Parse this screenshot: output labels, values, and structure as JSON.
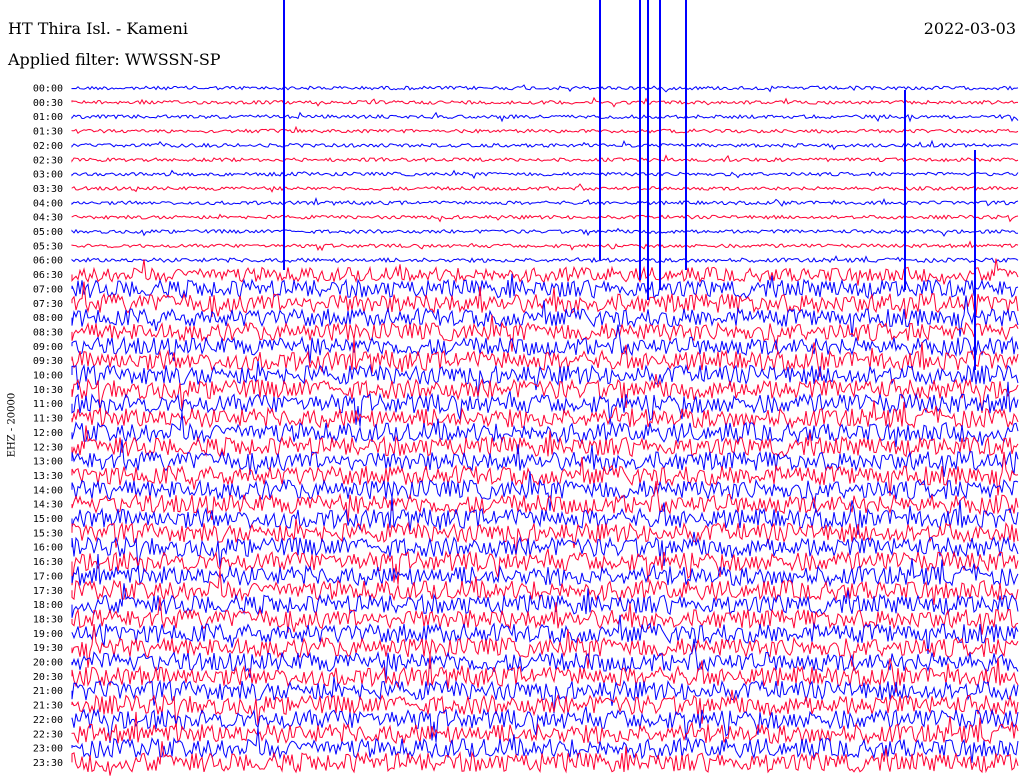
{
  "header": {
    "station": "HT Thira Isl. - Kameni",
    "date": "2022-03-03",
    "filter": "Applied filter: WWSSN-SP"
  },
  "chart_data": {
    "type": "line",
    "title": "HT Thira Isl. - Kameni",
    "ylabel": "EHZ - 20000",
    "rows": [
      "00:00",
      "00:30",
      "01:00",
      "01:30",
      "02:00",
      "02:30",
      "03:00",
      "03:30",
      "04:00",
      "04:30",
      "05:00",
      "05:30",
      "06:00",
      "06:30",
      "07:00",
      "07:30",
      "08:00",
      "08:30",
      "09:00",
      "09:30",
      "10:00",
      "10:30",
      "11:00",
      "11:30",
      "12:00",
      "12:30",
      "13:00",
      "13:30",
      "14:00",
      "14:30",
      "15:00",
      "15:30",
      "16:00",
      "16:30",
      "17:00",
      "17:30",
      "18:00",
      "18:30",
      "19:00",
      "19:30",
      "20:00",
      "20:30",
      "21:00",
      "21:30",
      "22:00",
      "22:30",
      "23:00",
      "23:30"
    ],
    "series_colors": [
      "#0000ff",
      "#ff0033"
    ],
    "amplitude": [
      0.3,
      0.3,
      0.3,
      0.3,
      0.3,
      0.3,
      0.3,
      0.3,
      0.3,
      0.3,
      0.3,
      0.3,
      0.35,
      1.2,
      1.5,
      1.6,
      1.5,
      1.5,
      1.5,
      1.6,
      1.6,
      1.6,
      1.6,
      1.6,
      1.6,
      1.6,
      1.6,
      1.6,
      1.6,
      1.6,
      1.6,
      1.6,
      1.6,
      1.6,
      1.6,
      1.6,
      1.6,
      1.6,
      1.6,
      1.6,
      1.6,
      1.6,
      1.6,
      1.6,
      1.6,
      1.6,
      1.6,
      1.6
    ],
    "grid": false
  }
}
